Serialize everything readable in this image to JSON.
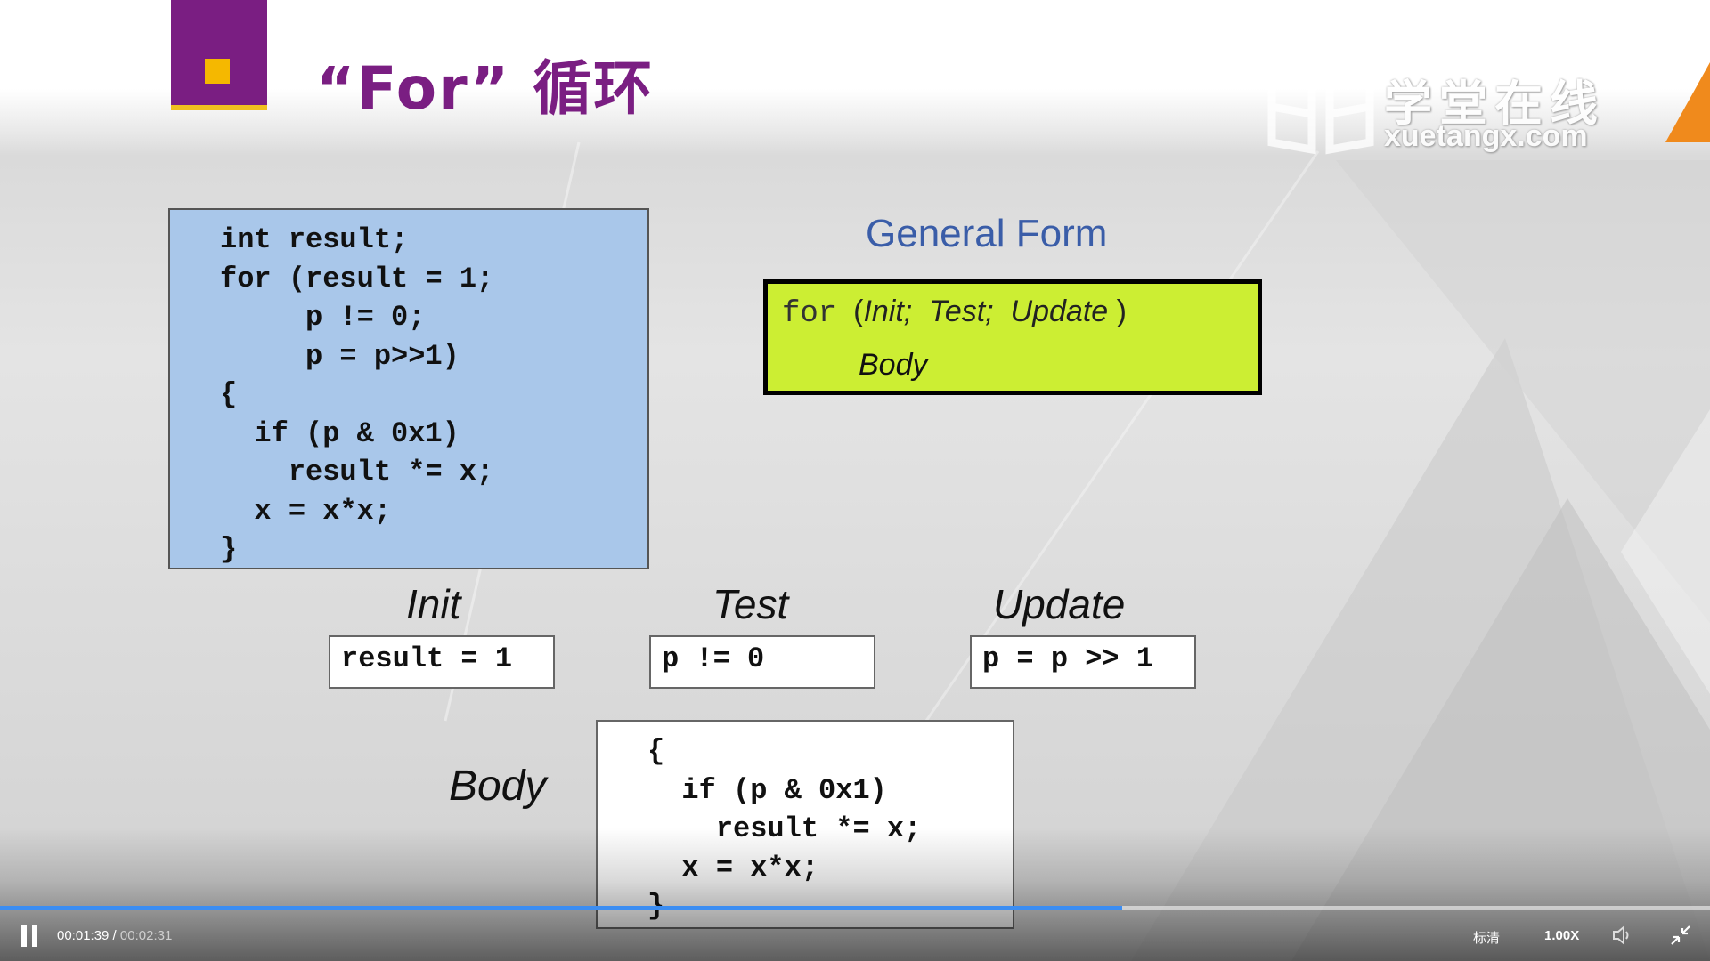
{
  "slide": {
    "title": "“For” 循环",
    "watermark_cn": "学堂在线",
    "watermark_en": "xuetangx.com"
  },
  "code_block": {
    "lines": [
      "int result;",
      "for (result = 1;",
      "     p != 0;",
      "     p = p>>1)",
      "{",
      "  if (p & 0x1)",
      "    result *= x;",
      "  x = x*x;",
      "}"
    ]
  },
  "general_form": {
    "heading": "General Form",
    "for_keyword": "for",
    "open_paren": "(",
    "init": "Init;",
    "test": "Test;",
    "update": "Update",
    "close_paren": ")",
    "body": "Body"
  },
  "parts": {
    "init_label": "Init",
    "init_code": "result = 1",
    "test_label": "Test",
    "test_code": "p != 0",
    "update_label": "Update",
    "update_code": "p = p >> 1",
    "body_label": "Body",
    "body_lines": [
      "{",
      "  if (p & 0x1)",
      "    result *= x;",
      "  x = x*x;",
      "}"
    ]
  },
  "player": {
    "current_time": "00:01:39",
    "separator": " / ",
    "total_time": "00:02:31",
    "progress_fraction": 0.656,
    "quality_label": "标清",
    "speed_label": "1.00X",
    "progress_color": "#3b8df2"
  },
  "colors": {
    "title_purple": "#7a1e82",
    "code_box_blue": "#a9c7ea",
    "general_form_green": "#ccee33",
    "heading_blue": "#3a5da8"
  }
}
